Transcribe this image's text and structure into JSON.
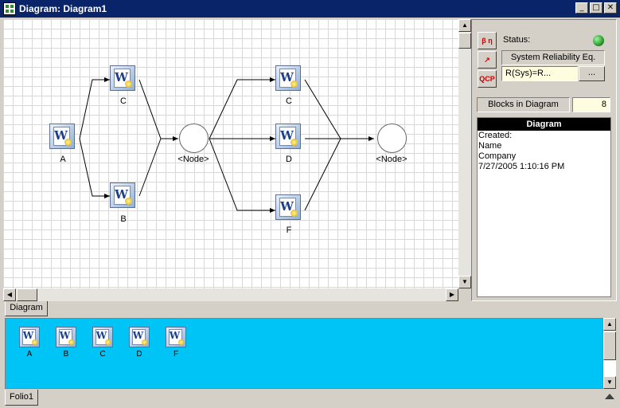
{
  "window": {
    "title": "Diagram: Diagram1",
    "controls": {
      "minimize": "_",
      "maximize": "□",
      "close": "✕"
    }
  },
  "diagram": {
    "blocks": [
      {
        "label": "A",
        "icon": "weibull-block-icon"
      },
      {
        "label": "C",
        "icon": "weibull-block-icon"
      },
      {
        "label": "B",
        "icon": "weibull-block-icon"
      },
      {
        "label": "C",
        "icon": "weibull-block-icon"
      },
      {
        "label": "D",
        "icon": "weibull-block-icon"
      },
      {
        "label": "F",
        "icon": "weibull-block-icon"
      }
    ],
    "nodes": [
      {
        "label": "<Node>"
      },
      {
        "label": "<Node>"
      }
    ]
  },
  "side_panel": {
    "tools": {
      "tool1": "β η",
      "tool2": "↗",
      "tool3": "QCP"
    },
    "status_label": "Status:",
    "status_color": "#1f8a1f",
    "equation_label": "System Reliability Eq.",
    "equation_value": "R(Sys)=R...",
    "ellipsis_button": "...",
    "blocks_label": "Blocks in Diagram",
    "blocks_count": "8",
    "info": {
      "header": "Diagram",
      "lines": [
        "Created:",
        "Name",
        "Company",
        "7/27/2005 1:10:16 PM"
      ]
    }
  },
  "tabs": {
    "diagram_tab": "Diagram",
    "folio_tab": "Folio1"
  },
  "folio": {
    "background": "#00c4f5",
    "items": [
      "A",
      "B",
      "C",
      "D",
      "F"
    ]
  }
}
